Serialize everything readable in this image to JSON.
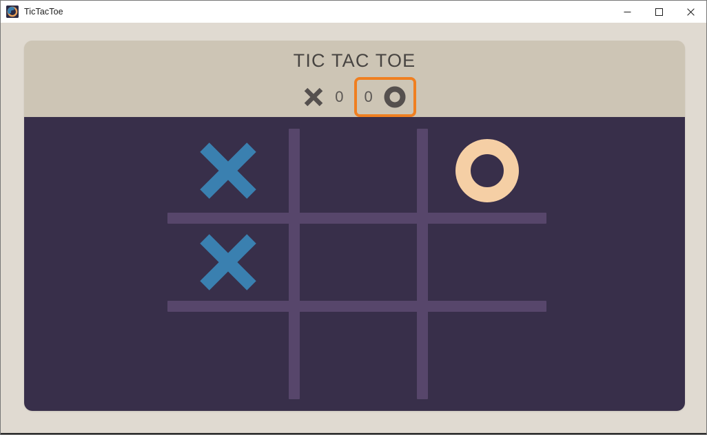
{
  "window": {
    "title": "TicTacToe",
    "icon": "app-icon",
    "controls": {
      "minimize": "minimize-icon",
      "maximize": "maximize-icon",
      "close": "close-icon"
    }
  },
  "game": {
    "title": "TIC TAC TOE",
    "scoreboard": {
      "x_player": {
        "mark": "x-mark-icon",
        "score": "0",
        "active": false
      },
      "o_player": {
        "mark": "o-mark-icon",
        "score": "0",
        "active": true
      },
      "active_highlight_color": "#f07f20"
    },
    "board": {
      "rows": 3,
      "cols": 3,
      "cells": [
        [
          "X",
          "",
          "O"
        ],
        [
          "X",
          "",
          ""
        ],
        [
          "",
          "",
          ""
        ]
      ]
    },
    "colors": {
      "window_background": "#e0dad1",
      "card_header": "#cdc5b5",
      "board_background": "#382f4a",
      "grid_line": "#57466b",
      "x_mark": "#3a80b0",
      "o_mark": "#f5cfa5",
      "title_text": "#474441",
      "score_text": "#5b5754",
      "scoreboard_mark": "#55504e"
    }
  }
}
